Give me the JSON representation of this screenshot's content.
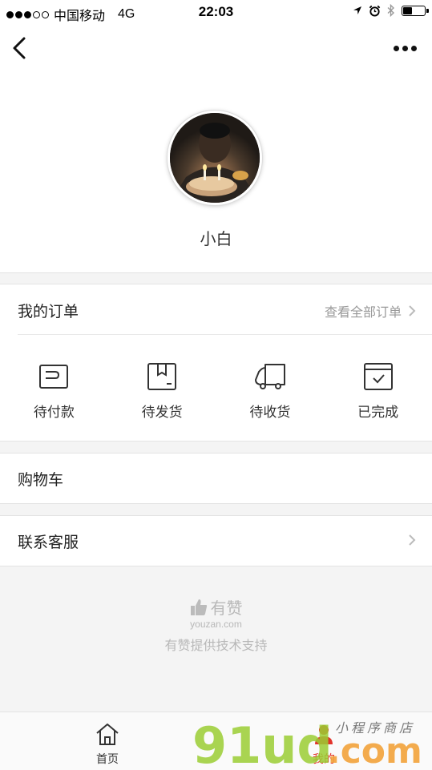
{
  "status_bar": {
    "carrier": "中国移动",
    "network": "4G",
    "time": "22:03"
  },
  "nav": {
    "back_icon": "chevron-left-icon",
    "more_icon": "more-dots-icon"
  },
  "profile": {
    "username": "小白"
  },
  "orders": {
    "title": "我的订单",
    "view_all": "查看全部订单",
    "items": [
      {
        "label": "待付款",
        "icon": "wallet-icon"
      },
      {
        "label": "待发货",
        "icon": "box-icon"
      },
      {
        "label": "待收货",
        "icon": "truck-icon"
      },
      {
        "label": "已完成",
        "icon": "completed-check-icon"
      }
    ]
  },
  "cart": {
    "label": "购物车"
  },
  "service": {
    "label": "联系客服"
  },
  "footer": {
    "brand": "有赞",
    "domain": "youzan.com",
    "support": "有赞提供技术支持"
  },
  "tab_bar": {
    "home_label": "首页",
    "mine_label": "我的"
  },
  "watermark": {
    "text": "91uda.com",
    "sub": "小程序商店"
  },
  "colors": {
    "accent": "#e2332b",
    "muted": "#999999",
    "background": "#f4f4f4"
  }
}
